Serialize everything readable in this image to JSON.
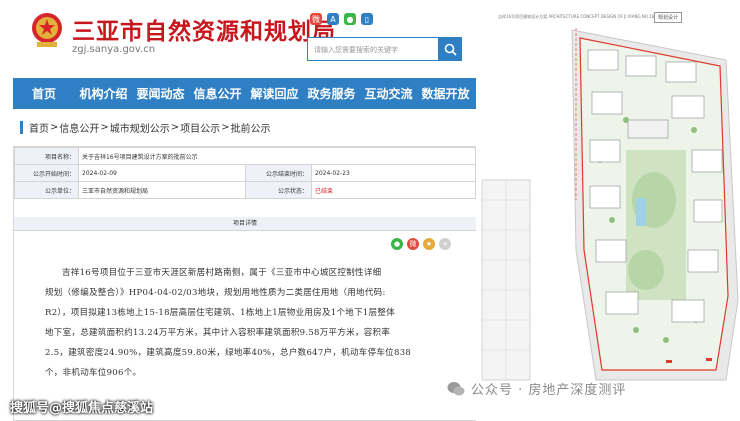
{
  "site": {
    "title": "三亚市自然资源和规划局",
    "url": "zgj.sanya.gov.cn",
    "search_placeholder": "请输入您需要搜索的关键字",
    "header_icons": [
      "weibo-icon",
      "app-icon",
      "wechat-icon",
      "mobile-icon"
    ],
    "accent_color": "#2f7fc4",
    "title_color": "#c8161d"
  },
  "nav": {
    "items": [
      "首页",
      "机构介绍",
      "要闻动态",
      "信息公开",
      "解读回应",
      "政务服务",
      "互动交流",
      "数据开放"
    ]
  },
  "breadcrumb": [
    "首页",
    "信息公开",
    "城市规划公示",
    "项目公示",
    "批前公示"
  ],
  "notice": {
    "project_name_label": "项目名称：",
    "project_name": "关于吉祥16号项目建筑设计方案的批前公示",
    "start_date_label": "公示开始时间：",
    "start_date": "2024-02-09",
    "end_date_label": "公示结束时间：",
    "end_date": "2024-02-23",
    "unit_label": "公示单位：",
    "unit": "三亚市自然资源和规划局",
    "status_label": "公示状态：",
    "status": "已结束",
    "detail_header": "项目详情",
    "paragraph_lines": [
      "吉祥16号项目位于三亚市天涯区新居村路南侧，属于《三亚市中心城区控制性详细",
      "规划（修编及整合）》HP04-04-02/03地块，规划用地性质为二类居住用地（用地代码:",
      "R2），项目拟建13栋地上15-18层高层住宅建筑、1栋地上1层物业用房及1个地下1层整体",
      "地下室，总建筑面积约13.24万平方米，其中计入容积率建筑面积9.58万平方米，容积率",
      "2.5，建筑密度24.90%，建筑高度59.80米，绿地率40%，总户数647户，机动车停车位838",
      "个，非机动车位906个。"
    ]
  },
  "plan": {
    "title": "吉祥16号项目建筑设计方案 ARCHITECTURE CONCEPT DESIGN OF JI XIANG NO.16",
    "label": "规划设计"
  },
  "watermarks": {
    "left": "搜狐号@搜狐焦点慈溪站",
    "right": "公众号 · 房地产深度测评"
  }
}
